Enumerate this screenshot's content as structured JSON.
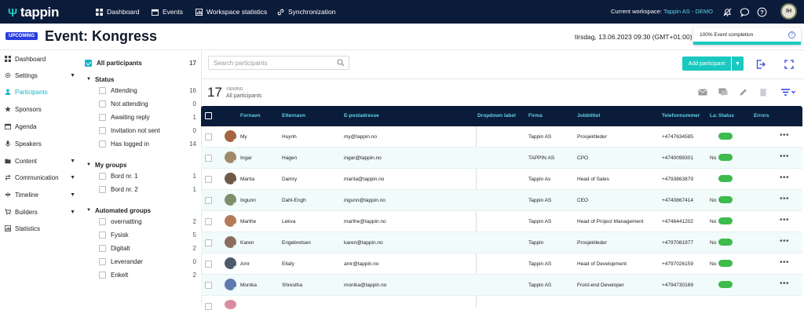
{
  "topbar": {
    "logo": "tappin",
    "nav": [
      {
        "label": "Dashboard",
        "icon": "grid-icon"
      },
      {
        "label": "Events",
        "icon": "calendar-icon"
      },
      {
        "label": "Workspace statistics",
        "icon": "chart-icon"
      },
      {
        "label": "Synchronization",
        "icon": "link-icon"
      }
    ],
    "workspace_label": "Current workspace:",
    "workspace_value": "Tappin AS - DEMO",
    "avatar_initials": "IH"
  },
  "event": {
    "badge": "UPCOMING",
    "title": "Event: Kongress",
    "datetime": "tirsdag, 13.06.2023 09:30 (GMT+01:00)",
    "completion": "100% Event completion"
  },
  "sidebar": {
    "items": [
      {
        "label": "Dashboard",
        "icon": "grid-icon",
        "chevron": false,
        "active": false
      },
      {
        "label": "Settings",
        "icon": "gear-icon",
        "chevron": true,
        "active": false
      },
      {
        "label": "Participants",
        "icon": "user-icon",
        "chevron": false,
        "active": true
      },
      {
        "label": "Sponsors",
        "icon": "star-icon",
        "chevron": false,
        "active": false
      },
      {
        "label": "Agenda",
        "icon": "calendar-icon",
        "chevron": false,
        "active": false
      },
      {
        "label": "Speakers",
        "icon": "mic-icon",
        "chevron": false,
        "active": false
      },
      {
        "label": "Content",
        "icon": "folder-icon",
        "chevron": true,
        "active": false
      },
      {
        "label": "Communication",
        "icon": "swap-icon",
        "chevron": true,
        "active": false
      },
      {
        "label": "Timeline",
        "icon": "timeline-icon",
        "chevron": true,
        "active": false
      },
      {
        "label": "Builders",
        "icon": "cart-icon",
        "chevron": true,
        "active": false
      },
      {
        "label": "Statistics",
        "icon": "bar-chart-icon",
        "chevron": false,
        "active": false
      }
    ]
  },
  "filters": {
    "all_label": "All participants",
    "all_count": "17",
    "status_title": "Status",
    "status": [
      {
        "label": "Attending",
        "count": "16"
      },
      {
        "label": "Not attending",
        "count": "0"
      },
      {
        "label": "Awaiting reply",
        "count": "1"
      },
      {
        "label": "Invitation not sent",
        "count": "0"
      },
      {
        "label": "Has logged in",
        "count": "14"
      }
    ],
    "mygroups_title": "My groups",
    "mygroups": [
      {
        "label": "Bord nr. 1",
        "count": "1"
      },
      {
        "label": "Bord nr. 2",
        "count": "1"
      }
    ],
    "auto_title": "Automated groups",
    "auto": [
      {
        "label": "overnatting",
        "count": "2"
      },
      {
        "label": "Fysisk",
        "count": "5"
      },
      {
        "label": "Digitalt",
        "count": "2"
      },
      {
        "label": "Leverandør",
        "count": "0"
      },
      {
        "label": "Enkelt",
        "count": "2"
      }
    ]
  },
  "main": {
    "search_placeholder": "Search participants",
    "add_button": "Add participant",
    "count": "17",
    "viewing": "VIEWING",
    "viewing_value": "All participants"
  },
  "table": {
    "headers": [
      "Fornavn",
      "Etternavn",
      "E-postadresse",
      "Dropdown label",
      "Firma",
      "Jobbtittel",
      "Telefonnummer",
      "La:",
      "Status",
      "Errors"
    ],
    "rows": [
      {
        "first": "My",
        "last": "Huynh",
        "email": "my@tappin.no",
        "firma": "Tappin AS",
        "title": "Prosjektleder",
        "phone": "+4747634585",
        "la": ""
      },
      {
        "first": "Ingar",
        "last": "Hagen",
        "email": "ingar@tappin.no",
        "firma": "TAPPIN AS",
        "title": "CPO",
        "phone": "+4740099301",
        "la": "No"
      },
      {
        "first": "Marita",
        "last": "Damry",
        "email": "marita@tappin.no",
        "firma": "Tappin As",
        "title": "Head of Sales",
        "phone": "+4793863879",
        "la": ""
      },
      {
        "first": "Ingunn",
        "last": "Dahl-Engh",
        "email": "ingunn@tappin.no",
        "firma": "Tappin AS",
        "title": "CEO",
        "phone": "+4740867414",
        "la": "No"
      },
      {
        "first": "Marthe",
        "last": "Lekva",
        "email": "marthe@tappin.no",
        "firma": "Tappin AS",
        "title": "Head of Project Management",
        "phone": "+4746441202",
        "la": "No"
      },
      {
        "first": "Karen",
        "last": "Engebretsen",
        "email": "karen@tappin.no",
        "firma": "Tappin",
        "title": "Prosjektleder",
        "phone": "+4797081977",
        "la": "No"
      },
      {
        "first": "Amr",
        "last": "Ellafy",
        "email": "amr@tappin.no",
        "firma": "Tappin AS",
        "title": "Head of Development",
        "phone": "+4797026159",
        "la": "No"
      },
      {
        "first": "Monika",
        "last": "Shrestha",
        "email": "monika@tappin.no",
        "firma": "Tappin AS",
        "title": "Front-end Developer",
        "phone": "+4794730169",
        "la": ""
      }
    ]
  },
  "colors": {
    "accent": "#19c8c0",
    "navy": "#0b1b3a",
    "status_on": "#3dbb4c",
    "upcoming": "#2a3ee0"
  }
}
